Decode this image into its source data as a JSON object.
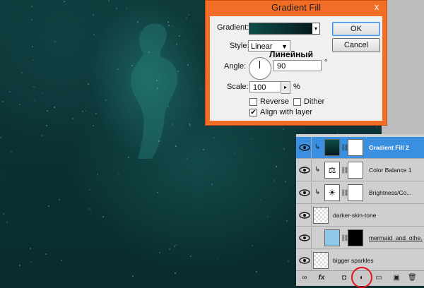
{
  "dialog": {
    "title": "Gradient Fill",
    "close_glyph": "x",
    "gradient_label": "Gradient:",
    "style_label": "Style:",
    "style_value": "Linear",
    "annotation": "Линейный",
    "angle_label": "Angle:",
    "angle_value": "90",
    "degree_symbol": "°",
    "scale_label": "Scale:",
    "scale_value": "100",
    "scale_unit": "%",
    "reverse_label": "Reverse",
    "reverse_checked": false,
    "dither_label": "Dither",
    "dither_checked": false,
    "align_label": "Align with layer",
    "align_checked": true,
    "ok_label": "OK",
    "cancel_label": "Cancel",
    "gradient_colors": [
      "#0e4e4a",
      "#061a1c"
    ]
  },
  "layers": [
    {
      "name": "Gradient Fill 2",
      "selected": true,
      "type": "gradient-fill",
      "clipped": true,
      "has_mask": true
    },
    {
      "name": "Color Balance 1",
      "selected": false,
      "type": "color-balance",
      "clipped": true,
      "has_mask": true
    },
    {
      "name": "Brightness/Co...",
      "selected": false,
      "type": "brightness-contrast",
      "clipped": true,
      "has_mask": true
    },
    {
      "name": "darker-skin-tone",
      "selected": false,
      "type": "pixel",
      "clipped": true,
      "has_mask": false
    },
    {
      "name": "mermaid_and_othe...",
      "selected": false,
      "type": "smart-object",
      "clipped": false,
      "has_mask": true
    },
    {
      "name": "bigger sparkles",
      "selected": false,
      "type": "pixel",
      "clipped": false,
      "has_mask": false
    }
  ],
  "layer_footer": {
    "icons": [
      "link-layers-icon",
      "fx-icon",
      "add-mask-icon",
      "new-fill-adjustment-icon",
      "new-group-icon",
      "new-layer-icon",
      "trash-icon"
    ],
    "fx_glyph": "fx"
  },
  "colors": {
    "dialog_frame": "#f26d26",
    "selected_layer": "#3a8fe0",
    "highlight_circle": "#e0141c"
  }
}
